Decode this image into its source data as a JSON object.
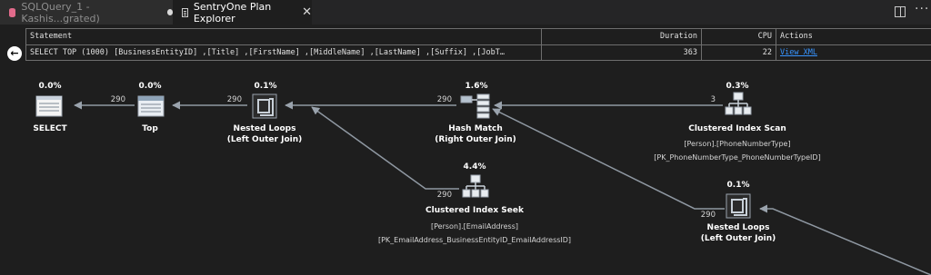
{
  "tabs": [
    {
      "label": "SQLQuery_1 - Kashis...grated)",
      "dirty": true
    },
    {
      "label": "SentryOne Plan Explorer",
      "active": true
    }
  ],
  "grid": {
    "headers": {
      "statement": "Statement",
      "duration": "Duration",
      "cpu": "CPU",
      "actions": "Actions"
    },
    "row": {
      "statement": "SELECT TOP (1000) [BusinessEntityID] ,[Title] ,[FirstName] ,[MiddleName] ,[LastName] ,[Suffix] ,[JobT…",
      "duration": "363",
      "cpu": "22",
      "action": "View XML"
    }
  },
  "plan": {
    "select": {
      "pct": "0.0%",
      "label": "SELECT"
    },
    "top": {
      "pct": "0.0%",
      "label": "Top"
    },
    "nested_loops_1": {
      "pct": "0.1%",
      "label1": "Nested Loops",
      "label2": "(Left Outer Join)"
    },
    "hash_match": {
      "pct": "1.6%",
      "label1": "Hash Match",
      "label2": "(Right Outer Join)"
    },
    "index_scan": {
      "pct": "0.3%",
      "label": "Clustered Index Scan",
      "sub1": "[Person].[PhoneNumberType]",
      "sub2": "[PK_PhoneNumberType_PhoneNumberTypeID]"
    },
    "index_seek": {
      "pct": "4.4%",
      "label": "Clustered Index Seek",
      "sub1": "[Person].[EmailAddress]",
      "sub2": "[PK_EmailAddress_BusinessEntityID_EmailAddressID]"
    },
    "nested_loops_2": {
      "pct": "0.1%",
      "label1": "Nested Loops",
      "label2": "(Left Outer Join)"
    },
    "edges": {
      "top_to_select": "290",
      "nl1_to_top": "290",
      "hash_to_nl1": "290",
      "scan_to_hash": "3",
      "seek_to_nl1": "290",
      "nl2_to_hash": "290"
    }
  }
}
